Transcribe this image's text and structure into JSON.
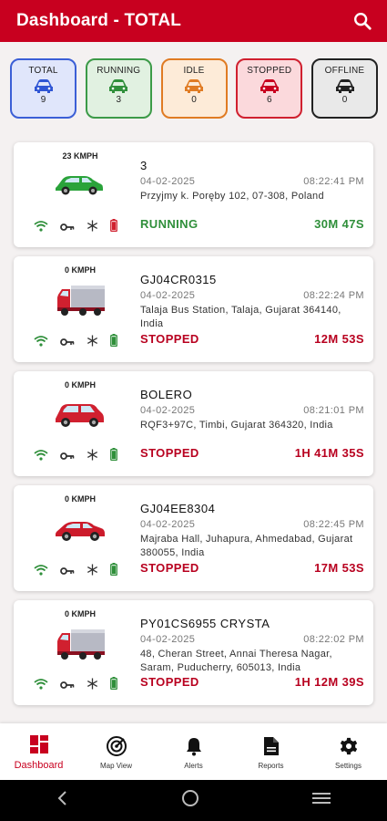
{
  "header": {
    "title": "Dashboard - TOTAL"
  },
  "filters": [
    {
      "label": "TOTAL",
      "count": "9",
      "border": "#3b5fd6",
      "bg": "#e0e6fb",
      "icon_color": "#2f55d4"
    },
    {
      "label": "RUNNING",
      "count": "3",
      "border": "#3c9a48",
      "bg": "#e1f1e1",
      "icon_color": "#2f8f3a"
    },
    {
      "label": "IDLE",
      "count": "0",
      "border": "#e07b23",
      "bg": "#fdebd8",
      "icon_color": "#e07b23"
    },
    {
      "label": "STOPPED",
      "count": "6",
      "border": "#d0202f",
      "bg": "#fbd9dc",
      "icon_color": "#c8001f"
    },
    {
      "label": "OFFLINE",
      "count": "0",
      "border": "#222222",
      "bg": "#e9e9e9",
      "icon_color": "#222222"
    }
  ],
  "vehicles": [
    {
      "speed": "23 KMPH",
      "name": "3",
      "date": "04-02-2025",
      "time": "08:22:41 PM",
      "address": "Przyjmy k. Poręby 102, 07-308, Poland",
      "status": "RUNNING",
      "duration": "30M 47S",
      "icon": "green-car-icon",
      "battery_color": "#d0202f"
    },
    {
      "speed": "0 KMPH",
      "name": "GJ04CR0315",
      "date": "04-02-2025",
      "time": "08:22:24 PM",
      "address": "Talaja Bus Station, Talaja, Gujarat 364140, India",
      "status": "STOPPED",
      "duration": "12M 53S",
      "icon": "red-truck-icon",
      "battery_color": "#2f8f3a"
    },
    {
      "speed": "0 KMPH",
      "name": "BOLERO",
      "date": "04-02-2025",
      "time": "08:21:01 PM",
      "address": "RQF3+97C, Timbi, Gujarat 364320, India",
      "status": "STOPPED",
      "duration": "1H 41M 35S",
      "icon": "red-suv-icon",
      "battery_color": "#2f8f3a"
    },
    {
      "speed": "0 KMPH",
      "name": "GJ04EE8304",
      "date": "04-02-2025",
      "time": "08:22:45 PM",
      "address": "Majraba Hall, Juhapura, Ahmedabad, Gujarat 380055, India",
      "status": "STOPPED",
      "duration": "17M 53S",
      "icon": "red-sedan-icon",
      "battery_color": "#2f8f3a"
    },
    {
      "speed": "0 KMPH",
      "name": "PY01CS6955 CRYSTA",
      "date": "04-02-2025",
      "time": "08:22:02 PM",
      "address": "48, Cheran Street, Annai Theresa Nagar, Saram, Puducherry, 605013, India",
      "status": "STOPPED",
      "duration": "1H 12M 39S",
      "icon": "red-truck-icon",
      "battery_color": "#2f8f3a"
    }
  ],
  "nav": [
    {
      "label": "Dashboard",
      "icon": "dashboard-icon",
      "active": true
    },
    {
      "label": "Map View",
      "icon": "map-view-icon",
      "active": false
    },
    {
      "label": "Alerts",
      "icon": "bell-icon",
      "active": false
    },
    {
      "label": "Reports",
      "icon": "document-icon",
      "active": false
    },
    {
      "label": "Settings",
      "icon": "gear-icon",
      "active": false
    }
  ],
  "colors": {
    "brand": "#c8001f",
    "running": "#2f8f3a",
    "stopped": "#b8001f"
  }
}
